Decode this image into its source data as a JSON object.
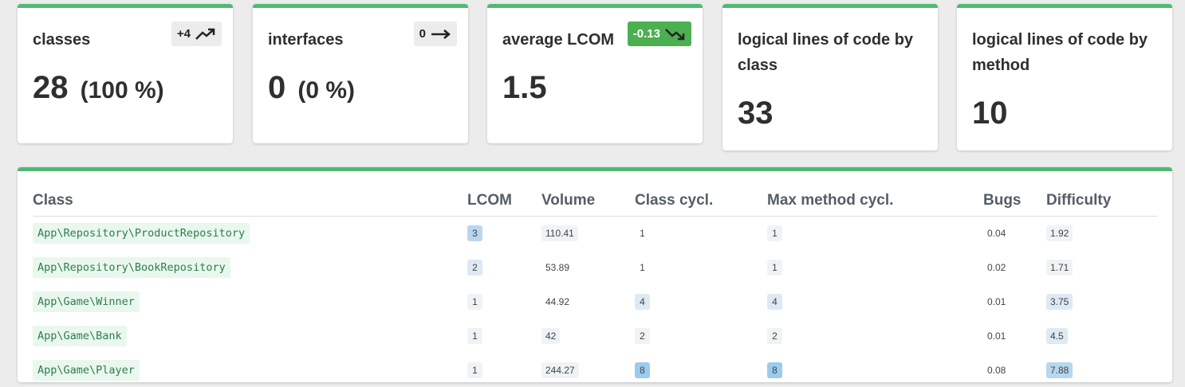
{
  "cards": [
    {
      "title": "classes",
      "value": "28",
      "percent": "(100 %)",
      "badge": "+4",
      "trend": "up"
    },
    {
      "title": "interfaces",
      "value": "0",
      "percent": "(0 %)",
      "badge": "0",
      "trend": "flat"
    },
    {
      "title": "average LCOM",
      "value": "1.5",
      "badge": "-0.13",
      "trend": "down",
      "badge_color": "#4caf50"
    },
    {
      "title": "logical lines of code by class",
      "value": "33"
    },
    {
      "title": "logical lines of code by method",
      "value": "10"
    }
  ],
  "table": {
    "headers": [
      "Class",
      "LCOM",
      "Volume",
      "Class cycl.",
      "Max method cycl.",
      "Bugs",
      "Difficulty"
    ],
    "rows": [
      {
        "class": "App\\Repository\\ProductRepository",
        "lcom": "3",
        "volume": "110.41",
        "class_cycl": "1",
        "max_method_cycl": "1",
        "bugs": "0.04",
        "difficulty": "1.92"
      },
      {
        "class": "App\\Repository\\BookRepository",
        "lcom": "2",
        "volume": "53.89",
        "class_cycl": "1",
        "max_method_cycl": "1",
        "bugs": "0.02",
        "difficulty": "1.71"
      },
      {
        "class": "App\\Game\\Winner",
        "lcom": "1",
        "volume": "44.92",
        "class_cycl": "4",
        "max_method_cycl": "4",
        "bugs": "0.01",
        "difficulty": "3.75"
      },
      {
        "class": "App\\Game\\Bank",
        "lcom": "1",
        "volume": "42",
        "class_cycl": "2",
        "max_method_cycl": "2",
        "bugs": "0.01",
        "difficulty": "4.5"
      },
      {
        "class": "App\\Game\\Player",
        "lcom": "1",
        "volume": "244.27",
        "class_cycl": "8",
        "max_method_cycl": "8",
        "bugs": "0.08",
        "difficulty": "7.88"
      }
    ]
  },
  "colors": {
    "accent": "#4fba72",
    "good_badge": "#4caf50",
    "class_chip_bg": "#e9f7ee"
  }
}
